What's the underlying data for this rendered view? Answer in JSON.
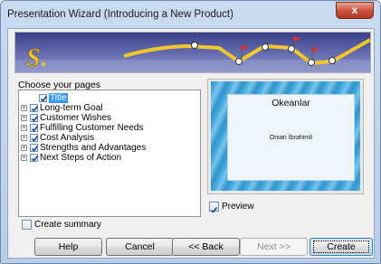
{
  "window": {
    "title": "Presentation Wizard (Introducing a New Product)",
    "close_glyph": "x"
  },
  "pages_section": {
    "label": "Choose your pages",
    "items": [
      {
        "label": "Title",
        "has_expander": false,
        "checked": true,
        "selected": true
      },
      {
        "label": "Long-term Goal",
        "has_expander": true,
        "checked": true,
        "selected": false
      },
      {
        "label": "Customer Wishes",
        "has_expander": true,
        "checked": true,
        "selected": false
      },
      {
        "label": "Fulfilling Customer Needs",
        "has_expander": true,
        "checked": true,
        "selected": false
      },
      {
        "label": "Cost Analysis",
        "has_expander": true,
        "checked": true,
        "selected": false
      },
      {
        "label": "Strengths and Advantages",
        "has_expander": true,
        "checked": true,
        "selected": false
      },
      {
        "label": "Next Steps of Action",
        "has_expander": true,
        "checked": true,
        "selected": false
      }
    ]
  },
  "preview": {
    "slide_title": "Okeanlar",
    "slide_subtitle": "Orxan İbrahimli",
    "checkbox_label": "Preview",
    "checked": true
  },
  "create_summary": {
    "label": "Create summary",
    "checked": false
  },
  "buttons": {
    "help": "Help",
    "cancel": "Cancel",
    "back": "<< Back",
    "next": "Next >>",
    "create": "Create"
  },
  "colors": {
    "selection": "#3399ff",
    "banner_track": "#f2c72b",
    "flag": "#e0312c"
  }
}
